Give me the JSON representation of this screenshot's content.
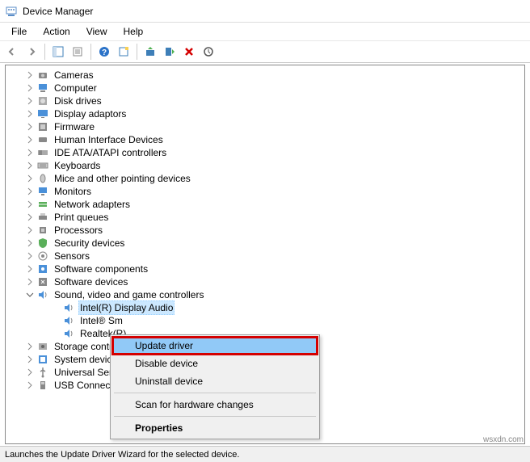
{
  "window": {
    "title": "Device Manager"
  },
  "menubar": {
    "file": "File",
    "action": "Action",
    "view": "View",
    "help": "Help"
  },
  "tree": {
    "categories": [
      {
        "label": "Cameras",
        "icon": "camera"
      },
      {
        "label": "Computer",
        "icon": "computer"
      },
      {
        "label": "Disk drives",
        "icon": "disk"
      },
      {
        "label": "Display adaptors",
        "icon": "display"
      },
      {
        "label": "Firmware",
        "icon": "firmware"
      },
      {
        "label": "Human Interface Devices",
        "icon": "hid"
      },
      {
        "label": "IDE ATA/ATAPI controllers",
        "icon": "ide"
      },
      {
        "label": "Keyboards",
        "icon": "keyboard"
      },
      {
        "label": "Mice and other pointing devices",
        "icon": "mouse"
      },
      {
        "label": "Monitors",
        "icon": "monitor"
      },
      {
        "label": "Network adapters",
        "icon": "network"
      },
      {
        "label": "Print queues",
        "icon": "printer"
      },
      {
        "label": "Processors",
        "icon": "processor"
      },
      {
        "label": "Security devices",
        "icon": "security"
      },
      {
        "label": "Sensors",
        "icon": "sensor"
      },
      {
        "label": "Software components",
        "icon": "softcomp"
      },
      {
        "label": "Software devices",
        "icon": "softdev"
      },
      {
        "label": "Sound, video and game controllers",
        "icon": "sound",
        "expanded": true
      }
    ],
    "sound_children": [
      {
        "label": "Intel(R) Display Audio",
        "selected": true,
        "truncated": "Intel(R) Display Audio"
      },
      {
        "label": "Intel® Sm",
        "truncated": "Intel® Sm"
      },
      {
        "label": "Realtek(R)",
        "truncated": "Realtek(R)"
      }
    ],
    "after_categories": [
      {
        "label": "Storage contr",
        "icon": "storage"
      },
      {
        "label": "System device",
        "icon": "system"
      },
      {
        "label": "Universal Seri",
        "icon": "usb"
      },
      {
        "label": "USB Connecto",
        "icon": "usbconn"
      }
    ]
  },
  "contextmenu": {
    "update": "Update driver",
    "disable": "Disable device",
    "uninstall": "Uninstall device",
    "scan": "Scan for hardware changes",
    "properties": "Properties"
  },
  "statusbar": {
    "text": "Launches the Update Driver Wizard for the selected device."
  },
  "watermark": "wsxdn.com"
}
